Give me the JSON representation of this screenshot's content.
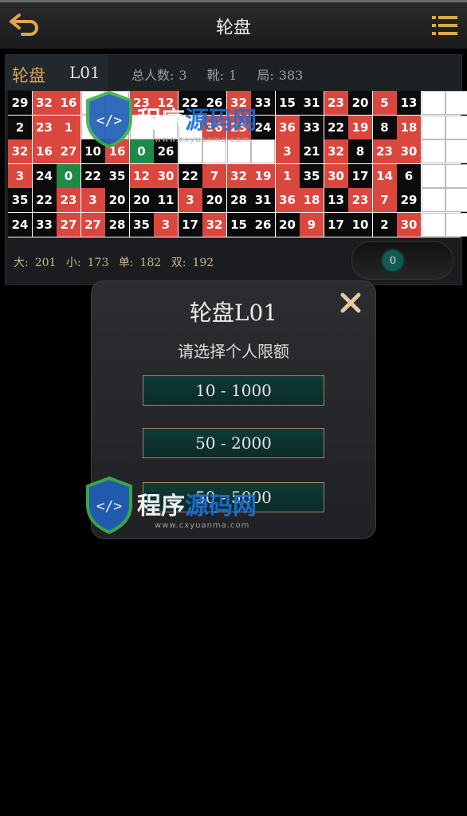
{
  "header": {
    "title": "轮盘"
  },
  "room": {
    "name": "轮盘",
    "code": "L01",
    "total_label": "总人数:",
    "total": "3",
    "boot_label": "靴:",
    "boot": "1",
    "round_label": "局:",
    "round": "383"
  },
  "road": {
    "columns": [
      [
        [
          "29",
          "b"
        ],
        [
          "2",
          "b"
        ],
        [
          "32",
          "r"
        ],
        [
          "3",
          "r"
        ],
        [
          "35",
          "b"
        ],
        [
          "24",
          "b"
        ]
      ],
      [
        [
          "32",
          "r"
        ],
        [
          "23",
          "r"
        ],
        [
          "16",
          "r"
        ],
        [
          "24",
          "b"
        ],
        [
          "22",
          "b"
        ],
        [
          "33",
          "b"
        ]
      ],
      [
        [
          "16",
          "r"
        ],
        [
          "1",
          "r"
        ],
        [
          "27",
          "r"
        ],
        [
          "0",
          "g"
        ],
        [
          "23",
          "r"
        ],
        [
          "27",
          "r"
        ]
      ],
      [
        [
          "",
          ""
        ],
        [
          "",
          ""
        ],
        [
          "10",
          "b"
        ],
        [
          "22",
          "b"
        ],
        [
          "3",
          "r"
        ],
        [
          "27",
          "r"
        ]
      ],
      [
        [
          "",
          ""
        ],
        [
          "",
          ""
        ],
        [
          "16",
          "r"
        ],
        [
          "35",
          "b"
        ],
        [
          "20",
          "b"
        ],
        [
          "28",
          "b"
        ]
      ],
      [
        [
          "23",
          "r"
        ],
        [
          "",
          ""
        ],
        [
          "0",
          "g"
        ],
        [
          "12",
          "r"
        ],
        [
          "20",
          "b"
        ],
        [
          "35",
          "b"
        ]
      ],
      [
        [
          "12",
          "r"
        ],
        [
          "",
          ""
        ],
        [
          "26",
          "b"
        ],
        [
          "30",
          "r"
        ],
        [
          "11",
          "b"
        ],
        [
          "3",
          "r"
        ]
      ],
      [
        [
          "22",
          "b"
        ],
        [
          "",
          ""
        ],
        [
          "",
          ""
        ],
        [
          "22",
          "b"
        ],
        [
          "3",
          "r"
        ],
        [
          "17",
          "b"
        ]
      ],
      [
        [
          "26",
          "b"
        ],
        [
          "36",
          "r"
        ],
        [
          "",
          ""
        ],
        [
          "7",
          "r"
        ],
        [
          "20",
          "b"
        ],
        [
          "32",
          "r"
        ]
      ],
      [
        [
          "32",
          "r"
        ],
        [
          "23",
          "r"
        ],
        [
          "",
          ""
        ],
        [
          "32",
          "r"
        ],
        [
          "28",
          "b"
        ],
        [
          "15",
          "b"
        ]
      ],
      [
        [
          "33",
          "b"
        ],
        [
          "24",
          "b"
        ],
        [
          "",
          ""
        ],
        [
          "19",
          "r"
        ],
        [
          "31",
          "b"
        ],
        [
          "26",
          "b"
        ]
      ],
      [
        [
          "15",
          "b"
        ],
        [
          "36",
          "r"
        ],
        [
          "3",
          "r"
        ],
        [
          "1",
          "r"
        ],
        [
          "36",
          "r"
        ],
        [
          "20",
          "b"
        ]
      ],
      [
        [
          "31",
          "b"
        ],
        [
          "33",
          "b"
        ],
        [
          "21",
          "b"
        ],
        [
          "35",
          "b"
        ],
        [
          "18",
          "r"
        ],
        [
          "9",
          "r"
        ]
      ],
      [
        [
          "23",
          "r"
        ],
        [
          "22",
          "b"
        ],
        [
          "32",
          "r"
        ],
        [
          "30",
          "r"
        ],
        [
          "13",
          "b"
        ],
        [
          "17",
          "b"
        ]
      ],
      [
        [
          "20",
          "b"
        ],
        [
          "19",
          "r"
        ],
        [
          "8",
          "b"
        ],
        [
          "17",
          "b"
        ],
        [
          "23",
          "r"
        ],
        [
          "10",
          "b"
        ]
      ],
      [
        [
          "5",
          "r"
        ],
        [
          "8",
          "b"
        ],
        [
          "23",
          "r"
        ],
        [
          "14",
          "r"
        ],
        [
          "7",
          "r"
        ],
        [
          "2",
          "b"
        ]
      ],
      [
        [
          "13",
          "b"
        ],
        [
          "18",
          "r"
        ],
        [
          "30",
          "r"
        ],
        [
          "6",
          "b"
        ],
        [
          "29",
          "b"
        ],
        [
          "30",
          "r"
        ]
      ]
    ]
  },
  "stats": {
    "big_label": "大:",
    "big": "201",
    "small_label": "小:",
    "small": "173",
    "odd_label": "单:",
    "odd": "182",
    "even_label": "双:",
    "even": "192"
  },
  "last_result": "0",
  "modal": {
    "title": "轮盘L01",
    "subtitle": "请选择个人限额",
    "options": [
      "10 - 1000",
      "50 - 2000",
      "50 - 5000"
    ]
  },
  "watermark": {
    "text_a": "程序",
    "text_b": "源码网",
    "url": "www.cxyuanma.com"
  },
  "colors": {
    "red": "#d9473f",
    "black": "#0b0b0b",
    "green": "#1e8a4a",
    "accent": "#d9a45a"
  }
}
